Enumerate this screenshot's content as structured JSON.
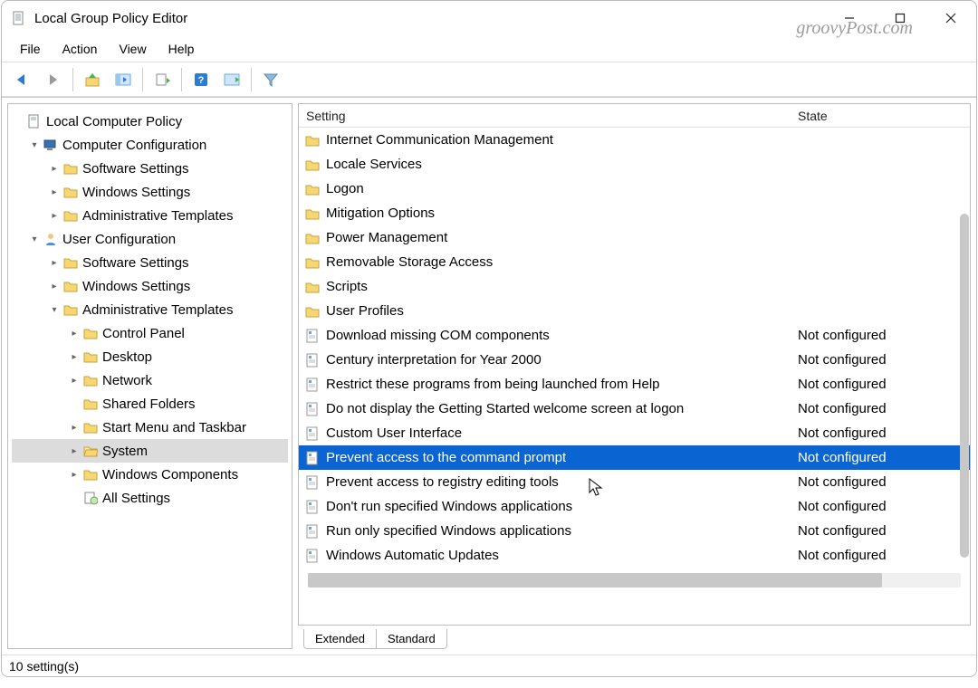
{
  "window": {
    "title": "Local Group Policy Editor"
  },
  "watermark": "groovyPost.com",
  "menu": {
    "file": "File",
    "action": "Action",
    "view": "View",
    "help": "Help"
  },
  "tree": {
    "root": "Local Computer Policy",
    "cc": "Computer Configuration",
    "cc_sw": "Software Settings",
    "cc_win": "Windows Settings",
    "cc_adm": "Administrative Templates",
    "uc": "User Configuration",
    "uc_sw": "Software Settings",
    "uc_win": "Windows Settings",
    "uc_adm": "Administrative Templates",
    "cp": "Control Panel",
    "desktop": "Desktop",
    "network": "Network",
    "shared": "Shared Folders",
    "startmenu": "Start Menu and Taskbar",
    "system": "System",
    "wincomp": "Windows Components",
    "allset": "All Settings"
  },
  "columns": {
    "setting": "Setting",
    "state": "State"
  },
  "state_values": {
    "not_configured": "Not configured"
  },
  "tabs": {
    "extended": "Extended",
    "standard": "Standard"
  },
  "status": "10 setting(s)",
  "rows": {
    "f0": "Internet Communication Management",
    "f1": "Locale Services",
    "f2": "Logon",
    "f3": "Mitigation Options",
    "f4": "Power Management",
    "f5": "Removable Storage Access",
    "f6": "Scripts",
    "f7": "User Profiles",
    "p0": "Download missing COM components",
    "p1": "Century interpretation for Year 2000",
    "p2": "Restrict these programs from being launched from Help",
    "p3": "Do not display the Getting Started welcome screen at logon",
    "p4": "Custom User Interface",
    "p5": "Prevent access to the command prompt",
    "p6": "Prevent access to registry editing tools",
    "p7": "Don't run specified Windows applications",
    "p8": "Run only specified Windows applications",
    "p9": "Windows Automatic Updates"
  }
}
